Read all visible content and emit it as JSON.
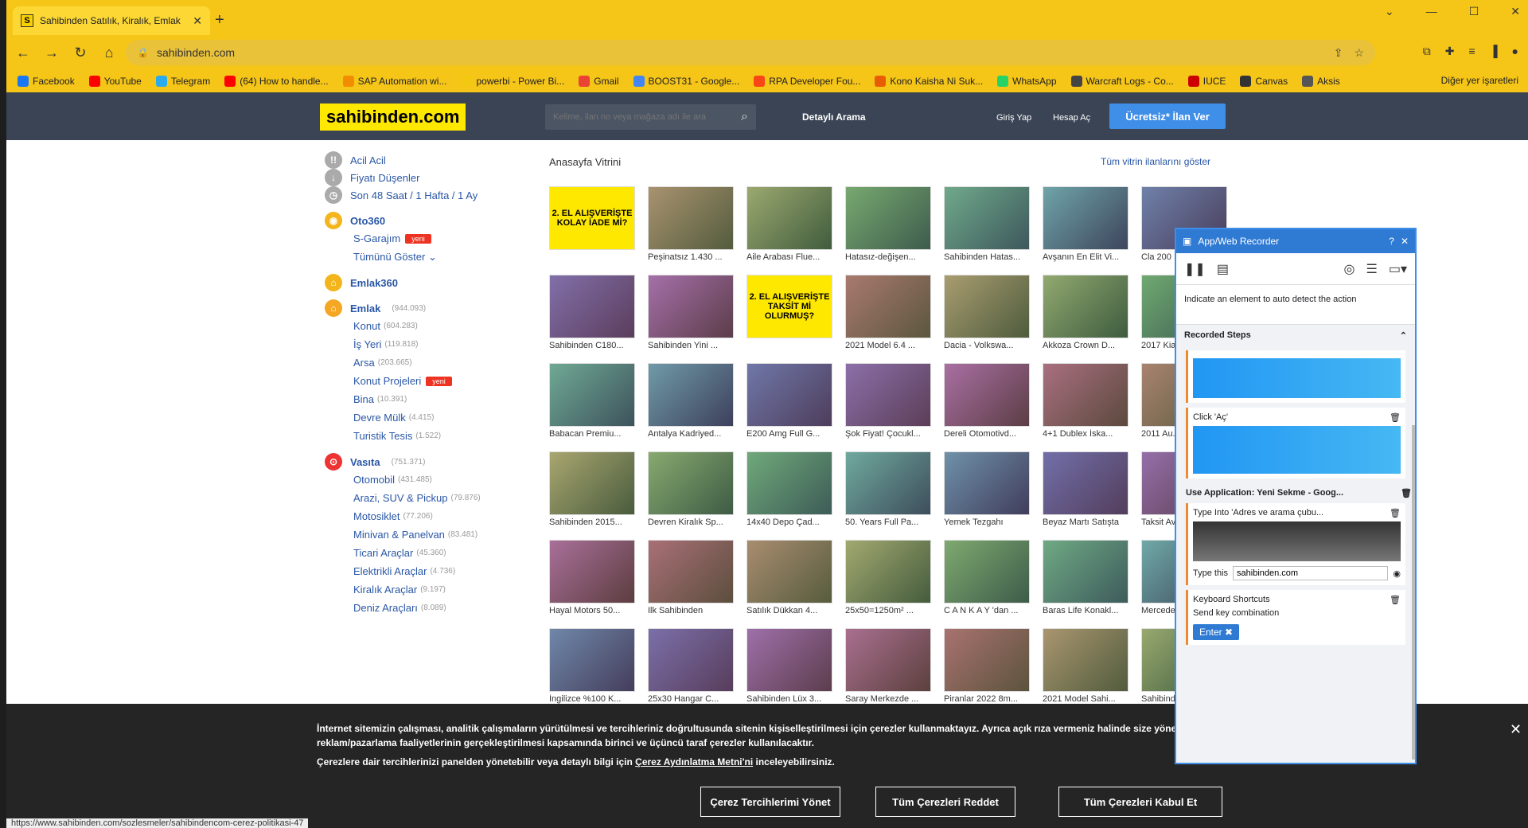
{
  "browser": {
    "tab_title": "Sahibinden Satılık, Kiralık, Emlak",
    "url": "sahibinden.com",
    "bookmarks": [
      "Facebook",
      "YouTube",
      "Telegram",
      "(64) How to handle...",
      "SAP Automation wi...",
      "powerbi - Power Bi...",
      "Gmail",
      "BOOST31 - Google...",
      "RPA Developer Fou...",
      "Kono Kaisha Ni Suk...",
      "WhatsApp",
      "Warcraft Logs - Co...",
      "IUCE",
      "Canvas",
      "Aksis"
    ],
    "bookmarks_more": "Diğer yer işaretleri",
    "status_url": "https://www.sahibinden.com/sozlesmeler/sahibindencom-cerez-politikasi-47"
  },
  "site": {
    "logo": "sahibinden.com",
    "search_placeholder": "Kelime, ilan no veya mağaza adı ile ara",
    "advanced_search": "Detaylı Arama",
    "login": "Giriş Yap",
    "register": "Hesap Aç",
    "post_ad": "Ücretsiz* İlan Ver"
  },
  "sidebar": {
    "quick": [
      "Acil Acil",
      "Fiyatı Düşenler",
      "Son 48 Saat / 1 Hafta / 1 Ay"
    ],
    "oto360": "Oto360",
    "garaj": "S-Garajım",
    "new_badge": "yeni",
    "show_all": "Tümünü Göster",
    "emlak360": "Emlak360",
    "emlak": {
      "label": "Emlak",
      "count": "(944.093)"
    },
    "emlak_items": [
      {
        "label": "Konut",
        "count": "(604.283)"
      },
      {
        "label": "İş Yeri",
        "count": "(119.818)"
      },
      {
        "label": "Arsa",
        "count": "(203.665)"
      },
      {
        "label": "Konut Projeleri",
        "count": ""
      },
      {
        "label": "Bina",
        "count": "(10.391)"
      },
      {
        "label": "Devre Mülk",
        "count": "(4.415)"
      },
      {
        "label": "Turistik Tesis",
        "count": "(1.522)"
      }
    ],
    "vasita": {
      "label": "Vasıta",
      "count": "(751.371)"
    },
    "vasita_items": [
      {
        "label": "Otomobil",
        "count": "(431.485)"
      },
      {
        "label": "Arazi, SUV & Pickup",
        "count": "(79.876)"
      },
      {
        "label": "Motosiklet",
        "count": "(77.206)"
      },
      {
        "label": "Minivan & Panelvan",
        "count": "(83.481)"
      },
      {
        "label": "Ticari Araçlar",
        "count": "(45.360)"
      },
      {
        "label": "Elektrikli Araçlar",
        "count": "(4.736)"
      },
      {
        "label": "Kiralık Araçlar",
        "count": "(9.197)"
      },
      {
        "label": "Deniz Araçları",
        "count": "(8.089)"
      }
    ]
  },
  "showcase": {
    "title": "Anasayfa Vitrini",
    "show_all": "Tüm vitrin ilanlarını göster",
    "captions": [
      "",
      "Peşinatsız 1.430 ...",
      "Aile Arabası Flue...",
      "Hatasız-değişen...",
      "Sahibinden Hatas...",
      "Avşanın En Elit Vi...",
      "Cla 200 ...",
      "Sahibinden C180...",
      "Sahibinden Yini ...",
      "",
      "2021 Model 6.4 ...",
      "Dacia - Volkswa...",
      "Akkoza Crown D...",
      "2017 Kia...",
      "Babacan Premiu...",
      "Antalya Kadriyed...",
      "E200 Amg Full G...",
      "Şok Fiyat! Çocukl...",
      "Dereli Otomotivd...",
      "4+1 Dublex İska...",
      "2011 Au...",
      "Sahibinden 2015...",
      "Devren Kiralık Sp...",
      "14x40 Depo Çad...",
      "50. Years Full Pa...",
      "Yemek Tezgahı",
      "Beyaz Martı Satışta",
      "Taksit Av...",
      "Hayal Motors 50...",
      "Ilk Sahibinden",
      "Satılık Dükkan 4...",
      "25x50=1250m² ...",
      "C A N K A Y 'dan ...",
      "Baras Life Konakl...",
      "Mercedes...",
      "İngilizce %100 K...",
      "25x30 Hangar C...",
      "Sahibinden Lüx 3...",
      "Saray Merkezde ...",
      "Piranlar 2022 8m...",
      "2021 Model Sahi...",
      "Sahibind..."
    ],
    "promo1": "2. EL ALIŞVERİŞTE KOLAY İADE Mİ?",
    "promo2": "2. EL ALIŞVERİŞTE TAKSİT Mİ OLURMUŞ?"
  },
  "cookie": {
    "text1": "İnternet sitemizin çalışması, analitik çalışmaların yürütülmesi ve tercihleriniz doğrultusunda sitenin kişiselleştirilmesi için çerezler kullanmaktayız. Ayrıca açık rıza vermeniz halinde size yönelik reklam/pazarlama faaliyetlerinin gerçekleştirilmesi kapsamında birinci ve üçüncü taraf çerezler kullanılacaktır.",
    "text2_pre": "Çerezlere dair tercihlerinizi panelden yönetebilir veya detaylı bilgi için",
    "text2_link": "Çerez Aydınlatma Metni'ni",
    "text2_post": "inceleyebilirsiniz.",
    "btn_manage": "Çerez Tercihlerimi Yönet",
    "btn_reject": "Tüm Çerezleri Reddet",
    "btn_accept": "Tüm Çerezleri Kabul Et"
  },
  "recorder": {
    "title": "App/Web Recorder",
    "hint": "Indicate an element to auto detect the action",
    "steps_label": "Recorded Steps",
    "step_click": "Click 'Aç'",
    "step_app": "Use Application: Yeni Sekme - Goog...",
    "step_type": "Type Into 'Adres ve arama çubu...",
    "type_label": "Type this",
    "type_value": "sahibinden.com",
    "step_keys": "Keyboard Shortcuts",
    "keys_label": "Send key combination",
    "key_value": "Enter"
  }
}
